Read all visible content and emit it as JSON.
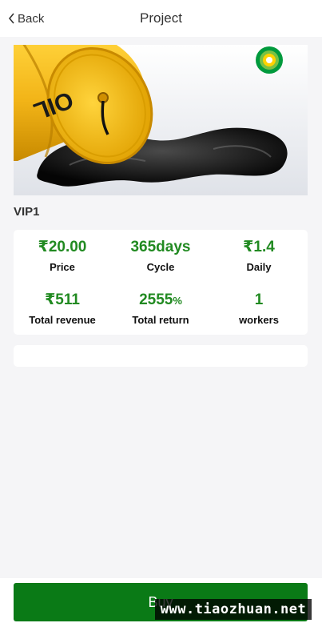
{
  "header": {
    "back_label": "Back",
    "title": "Project"
  },
  "hero": {
    "barrel_text": "OIL",
    "logo_icon": "bp-sunflower-logo",
    "colors": {
      "barrel": "#f2b417",
      "oil": "#0d0d0d",
      "logo_green": "#009a3d",
      "logo_yellow": "#ffd200"
    }
  },
  "product": {
    "name": "VIP1"
  },
  "stats": [
    {
      "value": "₹20.00",
      "label": "Price"
    },
    {
      "value": "365days",
      "label": "Cycle"
    },
    {
      "value": "₹1.4",
      "label": "Daily"
    },
    {
      "value": "₹511",
      "label": "Total revenue"
    },
    {
      "value": "2555",
      "unit": "%",
      "label": "Total return"
    },
    {
      "value": "1",
      "label": "workers"
    }
  ],
  "footer": {
    "buy_label": "Buy",
    "buy_color": "#0a7a16"
  },
  "watermark": "www.tiaozhuan.net",
  "colors": {
    "accent_value": "#218a21",
    "page_bg": "#f5f5f7"
  }
}
